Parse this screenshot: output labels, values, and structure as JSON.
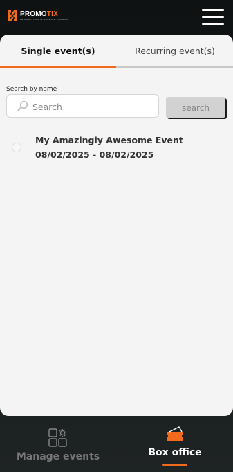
{
  "header": {
    "logo_text_main": "PROMO",
    "logo_text_accent": "TIX",
    "logo_tagline": "BE SMART. TICKETS. PROMOTE. INSIGHTS",
    "logo_icon": "promotix-logo-icon",
    "menu_icon": "hamburger-menu-icon"
  },
  "tabs": [
    {
      "label": "Single event(s)",
      "active": true
    },
    {
      "label": "Recurring event(s)",
      "active": false
    }
  ],
  "search": {
    "label": "Search by name",
    "placeholder": "Search",
    "value": "",
    "button_label": "search"
  },
  "events": [
    {
      "name": "My Amazingly Awesome Event",
      "dates": "08/02/2025 - 08/02/2025",
      "selected": false
    }
  ],
  "bottom_nav": [
    {
      "label": "Manage events",
      "icon": "grid-gear-icon",
      "active": false
    },
    {
      "label": "Box office",
      "icon": "ticket-icon",
      "active": true
    }
  ],
  "colors": {
    "accent": "#f26b1d",
    "background_dark": "#1a1e1e",
    "panel": "#f4f4f4"
  }
}
